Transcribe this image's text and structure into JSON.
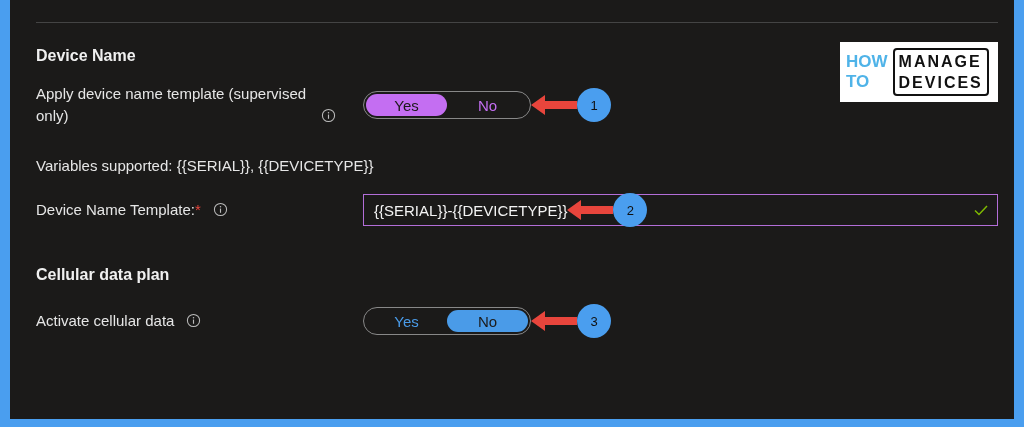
{
  "logo": {
    "word_1": "HOW",
    "word_2": "TO",
    "word_3": "MANAGE",
    "word_4": "DEVICES"
  },
  "sections": [
    {
      "heading": "Device Name",
      "rows": [
        {
          "kind": "toggle",
          "label": "Apply device name template (supervised only)",
          "info": true,
          "color": "#c46ef2",
          "callout": "1",
          "options": [
            {
              "label": "Yes",
              "selected": true
            },
            {
              "label": "No",
              "selected": false
            }
          ]
        },
        {
          "kind": "note",
          "label": "Variables supported: {{SERIAL}}, {{DEVICETYPE}}"
        },
        {
          "kind": "field",
          "label": "Device Name Template:",
          "required_mark": "*",
          "info": true,
          "value": "{{SERIAL}}-{{DEVICETYPE}}",
          "valid": true,
          "callout": "2"
        }
      ]
    },
    {
      "heading": "Cellular data plan",
      "rows": [
        {
          "kind": "toggle",
          "label": "Activate cellular data",
          "info": true,
          "color": "#4a9be8",
          "callout": "3",
          "options": [
            {
              "label": "Yes",
              "selected": false
            },
            {
              "label": "No",
              "selected": true
            }
          ]
        }
      ]
    }
  ]
}
